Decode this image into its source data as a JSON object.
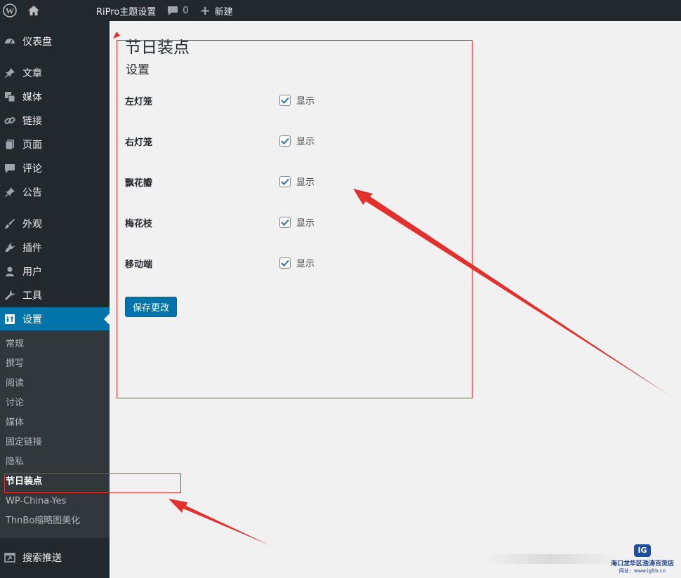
{
  "adminbar": {
    "site_name": "RiPro主题设置",
    "comments_count": "0",
    "new_label": "新建"
  },
  "sidebar": {
    "items": [
      {
        "label": "仪表盘",
        "icon": "dashboard-icon"
      },
      {
        "label": "文章",
        "icon": "pushpin-icon"
      },
      {
        "label": "媒体",
        "icon": "media-icon"
      },
      {
        "label": "链接",
        "icon": "link-icon"
      },
      {
        "label": "页面",
        "icon": "page-icon"
      },
      {
        "label": "评论",
        "icon": "comment-icon"
      },
      {
        "label": "公告",
        "icon": "pushpin-icon"
      },
      {
        "label": "外观",
        "icon": "brush-icon"
      },
      {
        "label": "插件",
        "icon": "plugin-icon"
      },
      {
        "label": "用户",
        "icon": "user-icon"
      },
      {
        "label": "工具",
        "icon": "wrench-icon"
      },
      {
        "label": "设置",
        "icon": "settings-icon"
      },
      {
        "label": "搜索推送",
        "icon": "search-push-icon"
      }
    ],
    "submenu": [
      "常规",
      "撰写",
      "阅读",
      "讨论",
      "媒体",
      "固定链接",
      "隐私",
      "节日装点",
      "WP-China-Yes",
      "ThnBo缩略图美化"
    ],
    "active_color": "#0073aa"
  },
  "main": {
    "page_title": "节日装点",
    "section_title": "设置",
    "rows": [
      {
        "label": "左灯笼",
        "option": "显示",
        "checked": true
      },
      {
        "label": "右灯笼",
        "option": "显示",
        "checked": true
      },
      {
        "label": "飘花瓣",
        "option": "显示",
        "checked": true
      },
      {
        "label": "梅花枝",
        "option": "显示",
        "checked": true
      },
      {
        "label": "移动端",
        "option": "显示",
        "checked": true
      }
    ],
    "save_label": "保存更改"
  },
  "watermark": {
    "logo_text": "IG",
    "line1": "海口龙华区浩涛百货店",
    "line2": "网址：www.igftb.cn"
  },
  "annotation_color": "#e2302d"
}
